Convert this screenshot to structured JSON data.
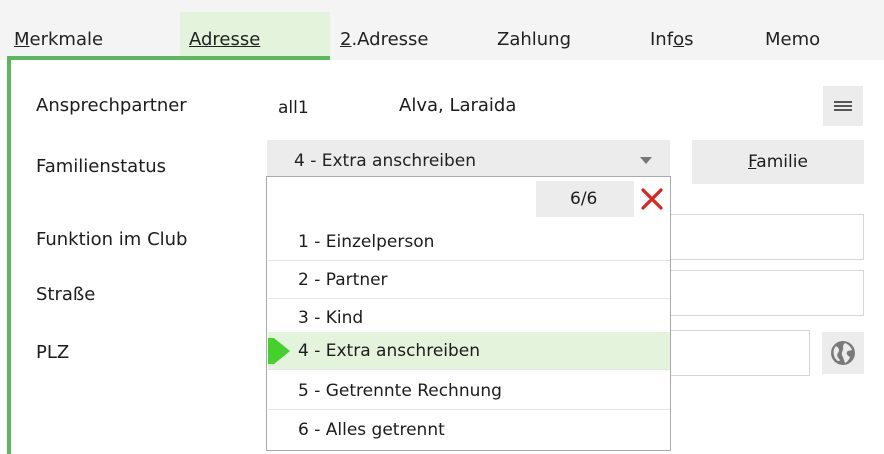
{
  "tabs": [
    {
      "prefix": "",
      "underline": "M",
      "rest": "erkmale"
    },
    {
      "prefix": "",
      "underline": "A",
      "rest": "dresse"
    },
    {
      "prefix": "",
      "underline": "2",
      "rest": ".Adresse"
    },
    {
      "prefix": "",
      "underline": "",
      "rest": "Zahlung"
    },
    {
      "prefix": "Inf",
      "underline": "o",
      "rest": "s"
    },
    {
      "prefix": "",
      "underline": "",
      "rest": "Memo"
    }
  ],
  "form": {
    "contact_label": "Ansprechpartner",
    "contact_code": "all1",
    "contact_name": "Alva, Laraida",
    "family_status_label": "Familienstatus",
    "family_status_value": "4 - Extra anschreiben",
    "family_button_ul": "F",
    "family_button_rest": "amilie",
    "function_label": "Funktion im Club",
    "street_label": "Straße",
    "zip_label": "PLZ"
  },
  "dropdown": {
    "count": "6/6",
    "options": [
      "1 - Einzelperson",
      "2 - Partner",
      "3 - Kind",
      "4 - Extra anschreiben",
      "5 - Getrennte Rechnung",
      "6 - Alles getrennt"
    ],
    "selected_index": 3
  },
  "icons": {
    "menu": "hamburger-icon",
    "close": "close-icon",
    "globe": "globe-icon",
    "caret": "chevron-down-icon"
  },
  "colors": {
    "accent": "#5cb85c",
    "selected_bg": "#e3f3dc",
    "close_red": "#e0241b"
  }
}
